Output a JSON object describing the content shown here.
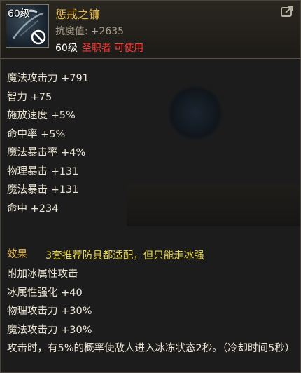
{
  "item": {
    "level_badge": "60级",
    "name": "惩戒之镰",
    "resist_label": "抗魔值:",
    "resist_value": "+2635",
    "req_level": "60级",
    "req_class": "圣职者 可使用"
  },
  "stats": [
    "魔法攻击力 +791",
    "智力 +75",
    "施放速度 +5%",
    "命中率 +5%",
    "魔法暴击率 +4%",
    "物理暴击 +131",
    "魔法暴击 +131",
    "命中 +234"
  ],
  "effect": {
    "title": "效果",
    "note": "3套推荐防具都适配，但只能走冰强",
    "lines": [
      "附加冰属性攻击",
      "冰属性强化 +40",
      "物理攻击力 +30%",
      "魔法攻击力 +30%",
      "攻击时，有5%的概率使敌人进入冰冻状态2秒。（冷却时间5秒）"
    ]
  },
  "icons": {
    "item_icon": "scythe-weapon-icon",
    "forbid": "forbidden-icon",
    "share": "share-icon"
  },
  "colors": {
    "name": "#e7b84a",
    "class_req": "#ff3b3b",
    "note": "#e8d64a"
  }
}
